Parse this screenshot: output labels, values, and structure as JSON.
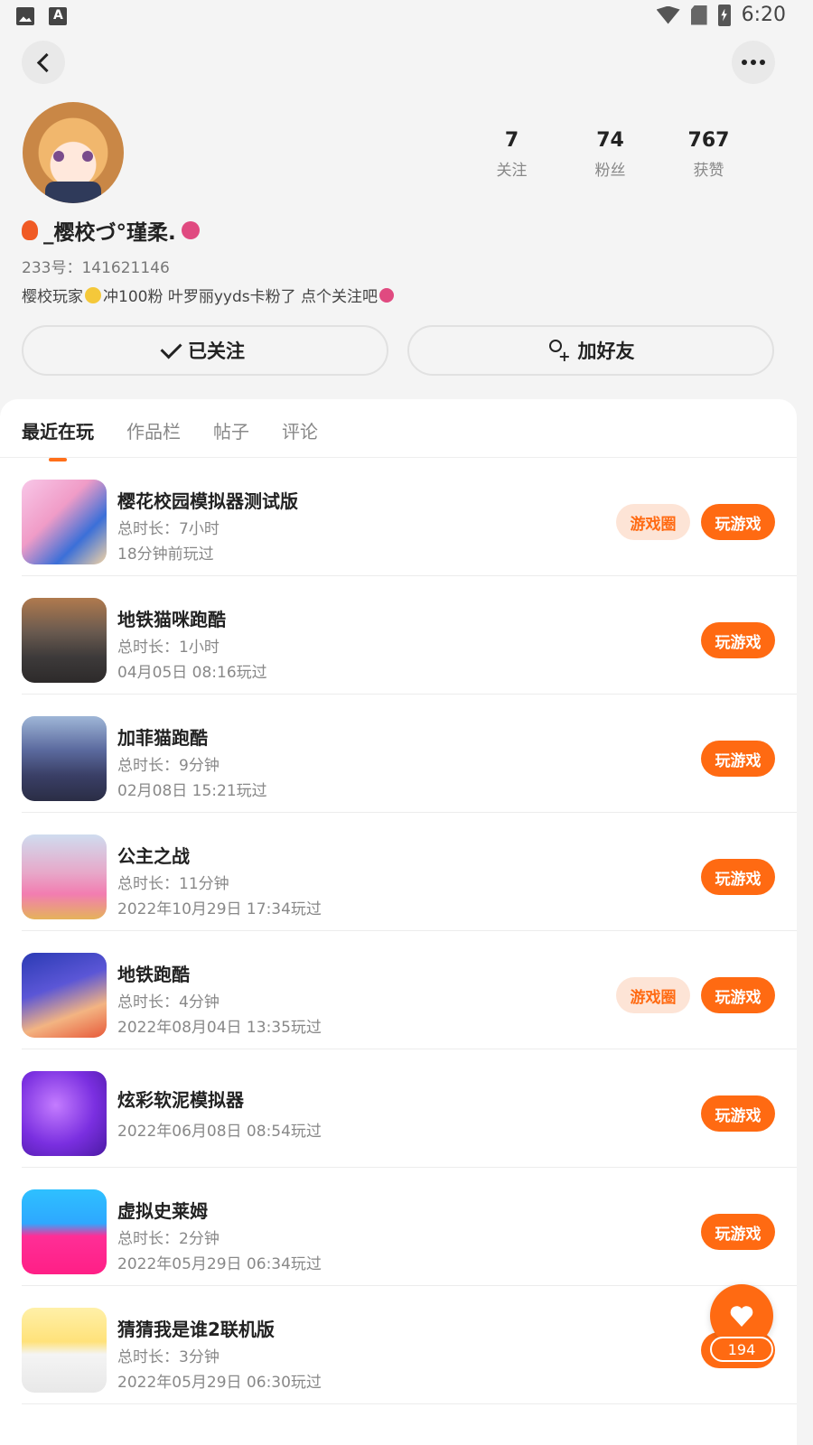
{
  "status_bar": {
    "time": "6:20"
  },
  "profile": {
    "name": "_樱校づ°瑾柔.",
    "uid": "233号：141621146",
    "bio_part1": "樱校玩家",
    "bio_part2": "冲100粉 叶罗丽yyds卡粉了 点个关注吧",
    "stats": [
      {
        "num": "7",
        "label": "关注"
      },
      {
        "num": "74",
        "label": "粉丝"
      },
      {
        "num": "767",
        "label": "获赞"
      }
    ],
    "follow_label": "已关注",
    "add_friend_label": "加好友"
  },
  "tabs": [
    "最近在玩",
    "作品栏",
    "帖子",
    "评论"
  ],
  "play_label": "玩游戏",
  "circle_label": "游戏圈",
  "games": [
    {
      "title": "樱花校园模拟器测试版",
      "duration": "总时长：7小时",
      "last": "18分钟前玩过",
      "circle": true
    },
    {
      "title": "地铁猫咪跑酷",
      "duration": "总时长：1小时",
      "last": "04月05日 08:16玩过"
    },
    {
      "title": "加菲猫跑酷",
      "duration": "总时长：9分钟",
      "last": "02月08日 15:21玩过"
    },
    {
      "title": "公主之战",
      "duration": "总时长：11分钟",
      "last": "2022年10月29日 17:34玩过"
    },
    {
      "title": "地铁跑酷",
      "duration": "总时长：4分钟",
      "last": "2022年08月04日 13:35玩过",
      "circle": true
    },
    {
      "title": "炫彩软泥模拟器",
      "last": "2022年06月08日 08:54玩过"
    },
    {
      "title": "虚拟史莱姆",
      "duration": "总时长：2分钟",
      "last": "2022年05月29日 06:34玩过"
    },
    {
      "title": "猜猜我是谁2联机版",
      "duration": "总时长：3分钟",
      "last": "2022年05月29日 06:30玩过"
    }
  ],
  "favorite_count": "194"
}
